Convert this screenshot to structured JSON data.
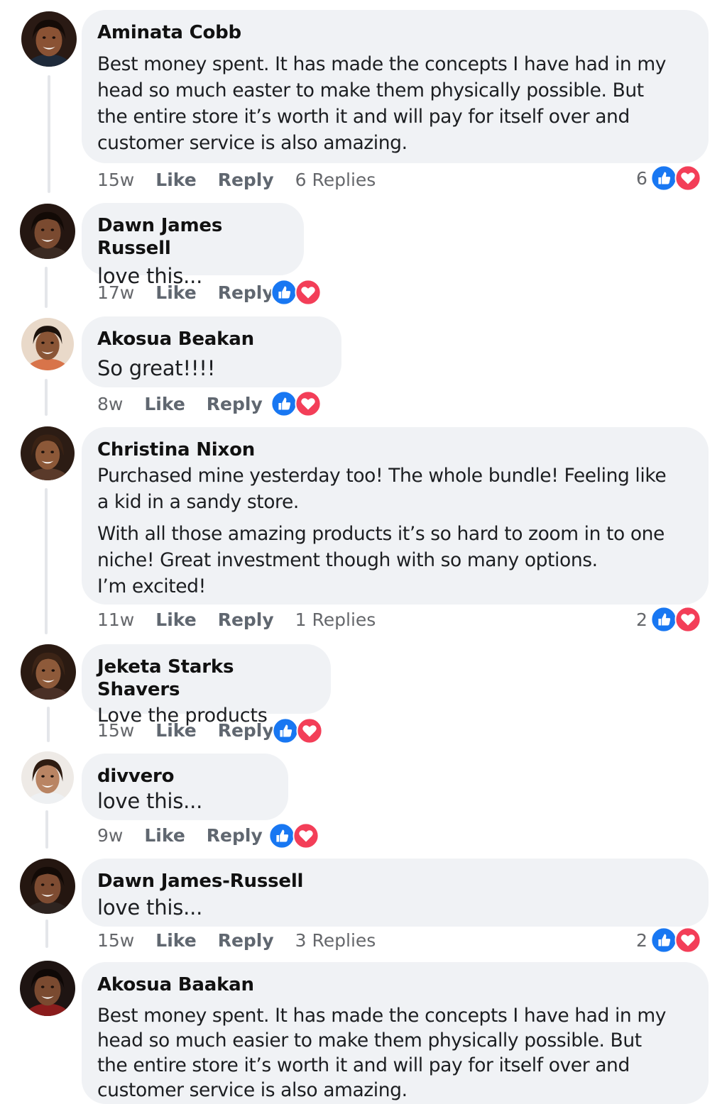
{
  "comments": [
    {
      "name": "Aminata Cobb",
      "paragraphs": [
        "Best money spent. It has made the concepts I have had in my\nhead so much easter to make them physically possible. But\nthe entire store it’s worth it and will pay for itself over and\ncustomer service is also amazing."
      ],
      "time": "15w",
      "like": "Like",
      "reply": "Reply",
      "replies": "6 Replies",
      "reaction_count": "6"
    },
    {
      "name": "Dawn James Russell",
      "paragraphs": [
        "love this..."
      ],
      "time": "17w",
      "like": "Like",
      "reply": "Reply"
    },
    {
      "name": "Akosua Beakan",
      "paragraphs": [
        "So great!!!!"
      ],
      "time": "8w",
      "like": "Like",
      "reply": "Reply"
    },
    {
      "name": "Christina Nixon",
      "paragraphs": [
        "Purchased mine yesterday too! The whole bundle! Feeling like\na kid in a sandy store.",
        "With all those amazing products it’s so hard to zoom in to one\nniche! Great investment though with so many options.\nI’m excited!"
      ],
      "time": "11w",
      "like": "Like",
      "reply": "Reply",
      "replies": "1 Replies",
      "reaction_count": "2"
    },
    {
      "name": "Jeketa Starks Shavers",
      "paragraphs": [
        "Love the products"
      ],
      "time": "15w",
      "like": "Like",
      "reply": "Reply"
    },
    {
      "name": "divvero",
      "paragraphs": [
        "love this..."
      ],
      "time": "9w",
      "like": "Like",
      "reply": "Reply"
    },
    {
      "name": "Dawn James-Russell",
      "paragraphs": [
        "love this..."
      ],
      "time": "15w",
      "like": "Like",
      "reply": "Reply",
      "replies": "3 Replies",
      "reaction_count": "2"
    },
    {
      "name": "Akosua Baakan",
      "paragraphs": [
        "Best money spent. It has made the concepts I have had in my\nhead so much easier to make them physically possible. But\nthe entire store it’s worth it and will pay for itself over and\ncustomer service is also amazing."
      ]
    }
  ],
  "icons": {
    "like": "thumbs-up-icon",
    "love": "heart-icon"
  },
  "colors": {
    "like_blue": "#1877f2",
    "love_red": "#f33e58",
    "bubble_bg": "#f0f2f5"
  }
}
